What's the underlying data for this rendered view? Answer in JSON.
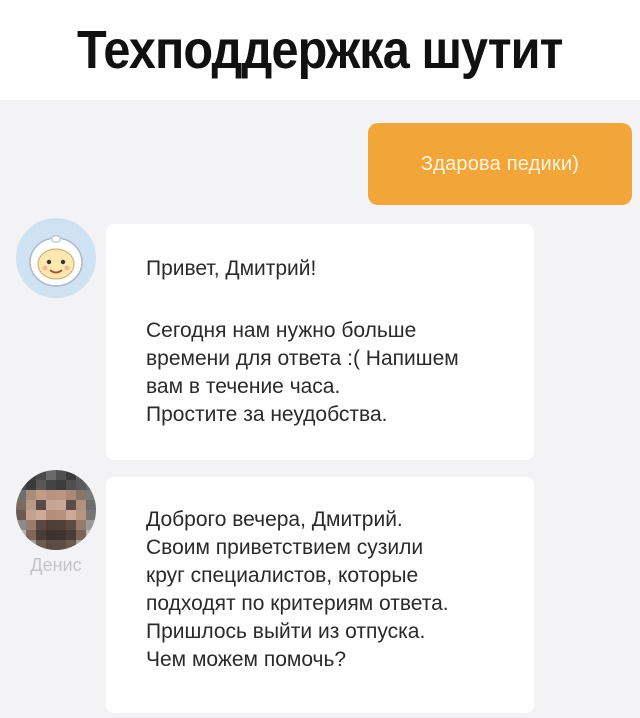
{
  "header": {
    "title": "Техподдержка шутит"
  },
  "chat": {
    "outgoing": {
      "text": "Здарова педики)"
    },
    "bot": {
      "greeting": "Привет, Дмитрий!",
      "lines": [
        "Сегодня нам нужно больше",
        "времени для ответа :( Напишем",
        "вам в течение часа.",
        "Простите за неудобства."
      ]
    },
    "agent": {
      "name": "Денис",
      "lines": [
        "Доброго вечера, Дмитрий.",
        "Своим приветствием сузили",
        "круг специалистов, которые",
        "подходят по критериям ответа.",
        "Пришлось выйти из отпуска.",
        "Чем можем помочь?"
      ]
    }
  },
  "colors": {
    "accent": "#f2a63a",
    "background": "#f3f3f5",
    "bubble": "#ffffff"
  },
  "icons": {
    "bot_avatar": "astronaut-avatar-icon",
    "agent_avatar": "pixelated-face-avatar"
  }
}
